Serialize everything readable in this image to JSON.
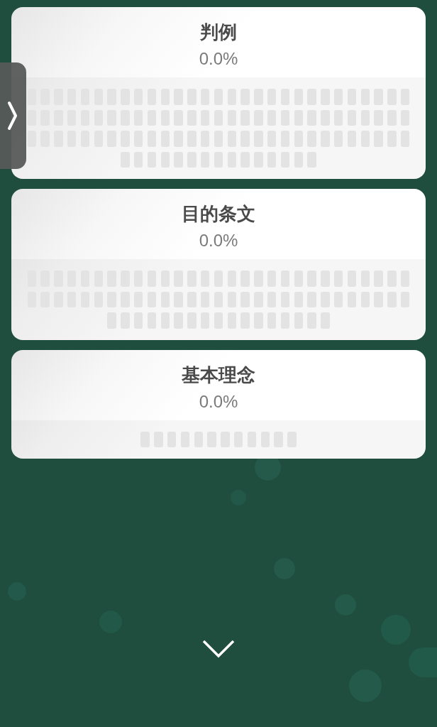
{
  "categories": [
    {
      "title": "判例",
      "progress": "0.0%",
      "questions": [
        {
          "answered": false
        },
        {
          "answered": false
        },
        {
          "answered": false
        },
        {
          "answered": false
        },
        {
          "answered": false
        },
        {
          "answered": false
        },
        {
          "answered": false
        },
        {
          "answered": false
        },
        {
          "answered": false
        },
        {
          "answered": false
        },
        {
          "answered": false
        },
        {
          "answered": false
        },
        {
          "answered": false
        },
        {
          "answered": false
        },
        {
          "answered": false
        },
        {
          "answered": false
        },
        {
          "answered": false
        },
        {
          "answered": false
        },
        {
          "answered": false
        },
        {
          "answered": false
        },
        {
          "answered": false
        },
        {
          "answered": false
        },
        {
          "answered": false
        },
        {
          "answered": false
        },
        {
          "answered": false
        },
        {
          "answered": false
        },
        {
          "answered": false
        },
        {
          "answered": false
        },
        {
          "answered": false
        },
        {
          "answered": false
        },
        {
          "answered": false
        },
        {
          "answered": false
        },
        {
          "answered": false
        },
        {
          "answered": false
        },
        {
          "answered": false
        },
        {
          "answered": false
        },
        {
          "answered": false
        },
        {
          "answered": false
        },
        {
          "answered": false
        },
        {
          "answered": false
        },
        {
          "answered": false
        },
        {
          "answered": false
        },
        {
          "answered": false
        },
        {
          "answered": false
        },
        {
          "answered": false
        },
        {
          "answered": false
        },
        {
          "answered": false
        },
        {
          "answered": false
        },
        {
          "answered": false
        },
        {
          "answered": false
        },
        {
          "answered": false
        },
        {
          "answered": false
        },
        {
          "answered": false
        },
        {
          "answered": false
        },
        {
          "answered": false
        },
        {
          "answered": false
        },
        {
          "answered": false
        },
        {
          "answered": false
        },
        {
          "answered": false
        },
        {
          "answered": false
        },
        {
          "answered": false
        },
        {
          "answered": false
        },
        {
          "answered": false
        },
        {
          "answered": false
        },
        {
          "answered": false
        },
        {
          "answered": false
        },
        {
          "answered": false
        },
        {
          "answered": false
        },
        {
          "answered": false
        },
        {
          "answered": false
        },
        {
          "answered": false
        },
        {
          "answered": false
        },
        {
          "answered": false
        },
        {
          "answered": false
        },
        {
          "answered": false
        },
        {
          "answered": false
        },
        {
          "answered": false
        },
        {
          "answered": false
        },
        {
          "answered": false
        },
        {
          "answered": false
        },
        {
          "answered": false
        },
        {
          "answered": false
        },
        {
          "answered": false
        },
        {
          "answered": false
        },
        {
          "answered": false
        },
        {
          "answered": false
        },
        {
          "answered": false
        },
        {
          "answered": false
        },
        {
          "answered": false
        },
        {
          "answered": false
        },
        {
          "answered": false
        },
        {
          "answered": false
        },
        {
          "answered": false
        },
        {
          "answered": false
        },
        {
          "answered": false
        },
        {
          "answered": false
        },
        {
          "answered": false
        },
        {
          "answered": false
        },
        {
          "answered": false
        },
        {
          "answered": false
        },
        {
          "answered": false
        },
        {
          "answered": false
        }
      ]
    },
    {
      "title": "目的条文",
      "progress": "0.0%",
      "questions": [
        {
          "answered": false
        },
        {
          "answered": false
        },
        {
          "answered": false
        },
        {
          "answered": false
        },
        {
          "answered": false
        },
        {
          "answered": false
        },
        {
          "answered": false
        },
        {
          "answered": false
        },
        {
          "answered": false
        },
        {
          "answered": false
        },
        {
          "answered": false
        },
        {
          "answered": false
        },
        {
          "answered": false
        },
        {
          "answered": false
        },
        {
          "answered": false
        },
        {
          "answered": false
        },
        {
          "answered": false
        },
        {
          "answered": false
        },
        {
          "answered": false
        },
        {
          "answered": false
        },
        {
          "answered": false
        },
        {
          "answered": false
        },
        {
          "answered": false
        },
        {
          "answered": false
        },
        {
          "answered": false
        },
        {
          "answered": false
        },
        {
          "answered": false
        },
        {
          "answered": false
        },
        {
          "answered": false
        },
        {
          "answered": false
        },
        {
          "answered": false
        },
        {
          "answered": false
        },
        {
          "answered": false
        },
        {
          "answered": false
        },
        {
          "answered": false
        },
        {
          "answered": false
        },
        {
          "answered": false
        },
        {
          "answered": false
        },
        {
          "answered": false
        },
        {
          "answered": false
        },
        {
          "answered": false
        },
        {
          "answered": false
        },
        {
          "answered": false
        },
        {
          "answered": false
        },
        {
          "answered": false
        },
        {
          "answered": false
        },
        {
          "answered": false
        },
        {
          "answered": false
        },
        {
          "answered": false
        },
        {
          "answered": false
        },
        {
          "answered": false
        },
        {
          "answered": false
        },
        {
          "answered": false
        },
        {
          "answered": false
        },
        {
          "answered": false
        },
        {
          "answered": false
        },
        {
          "answered": false
        },
        {
          "answered": false
        },
        {
          "answered": false
        },
        {
          "answered": false
        },
        {
          "answered": false
        },
        {
          "answered": false
        },
        {
          "answered": false
        },
        {
          "answered": false
        },
        {
          "answered": false
        },
        {
          "answered": false
        },
        {
          "answered": false
        },
        {
          "answered": false
        },
        {
          "answered": false
        },
        {
          "answered": false
        },
        {
          "answered": false
        },
        {
          "answered": false
        },
        {
          "answered": false
        },
        {
          "answered": false
        },
        {
          "answered": false
        }
      ]
    },
    {
      "title": "基本理念",
      "progress": "0.0%",
      "questions": [
        {
          "answered": false
        },
        {
          "answered": false
        },
        {
          "answered": false
        },
        {
          "answered": false
        },
        {
          "answered": false
        },
        {
          "answered": false
        },
        {
          "answered": false
        },
        {
          "answered": false
        },
        {
          "answered": false
        },
        {
          "answered": false
        },
        {
          "answered": false
        },
        {
          "answered": false
        }
      ]
    }
  ]
}
